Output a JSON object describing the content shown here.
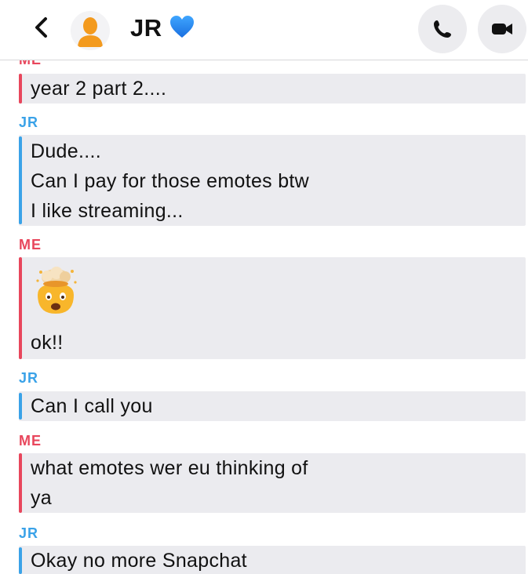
{
  "header": {
    "contact_name": "JR",
    "icons": {
      "back": "chevron-left-icon",
      "avatar": "bitmoji-placeholder-icon",
      "heart": "blue-heart-icon",
      "call": "phone-icon",
      "video": "video-camera-icon"
    }
  },
  "colors": {
    "me": "#e8465c",
    "jr": "#3aa2e8",
    "bubble": "#ebebef"
  },
  "messages": [
    {
      "sender": "ME",
      "lines": [
        "year 2 part 2...."
      ]
    },
    {
      "sender": "JR",
      "lines": [
        "Dude....",
        "Can I pay for those emotes btw",
        "I like streaming..."
      ]
    },
    {
      "sender": "ME",
      "emoji": "exploding-head-emoji",
      "lines": [
        "ok!!"
      ]
    },
    {
      "sender": "JR",
      "lines": [
        "Can I call you"
      ]
    },
    {
      "sender": "ME",
      "lines": [
        "what emotes wer eu thinking of",
        "ya"
      ]
    },
    {
      "sender": "JR",
      "lines": [
        "Okay no more Snapchat"
      ]
    }
  ]
}
